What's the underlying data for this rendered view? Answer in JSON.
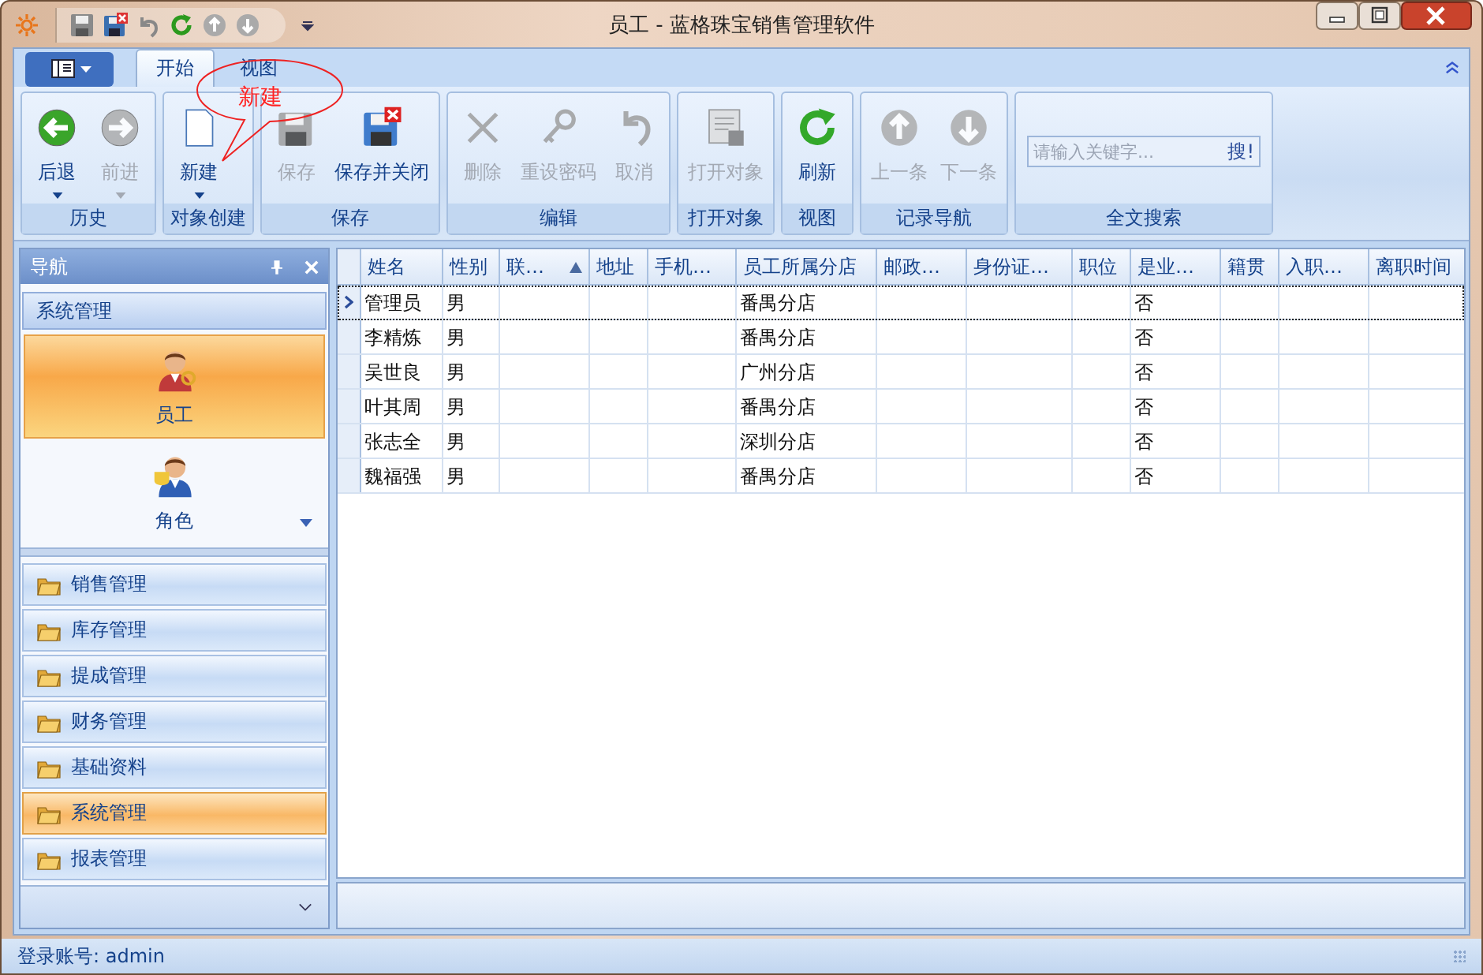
{
  "window": {
    "title": "员工 - 蓝格珠宝销售管理软件"
  },
  "ribbon": {
    "tabs": [
      {
        "label": "开始",
        "selected": true
      },
      {
        "label": "视图",
        "selected": false
      }
    ],
    "callout": {
      "text": "新建"
    },
    "groups": [
      {
        "caption": "历史",
        "buttons": [
          {
            "label": "后退",
            "kind": "back",
            "disabled": false,
            "dropdown": true
          },
          {
            "label": "前进",
            "kind": "forward",
            "disabled": true,
            "dropdown": true
          }
        ]
      },
      {
        "caption": "对象创建",
        "buttons": [
          {
            "label": "新建",
            "kind": "new",
            "disabled": false,
            "dropdown": true
          }
        ]
      },
      {
        "caption": "保存",
        "buttons": [
          {
            "label": "保存",
            "kind": "save",
            "disabled": true,
            "dropdown": false
          },
          {
            "label": "保存并关闭",
            "kind": "saveclose",
            "disabled": false,
            "dropdown": false
          }
        ]
      },
      {
        "caption": "编辑",
        "buttons": [
          {
            "label": "删除",
            "kind": "delete",
            "disabled": true,
            "dropdown": false
          },
          {
            "label": "重设密码",
            "kind": "key",
            "disabled": true,
            "dropdown": false
          },
          {
            "label": "取消",
            "kind": "undo",
            "disabled": true,
            "dropdown": false
          }
        ]
      },
      {
        "caption": "打开对象",
        "buttons": [
          {
            "label": "打开对象",
            "kind": "open",
            "disabled": true,
            "dropdown": false
          }
        ]
      },
      {
        "caption": "视图",
        "buttons": [
          {
            "label": "刷新",
            "kind": "refresh",
            "disabled": false,
            "dropdown": false
          }
        ]
      },
      {
        "caption": "记录导航",
        "buttons": [
          {
            "label": "上一条",
            "kind": "up",
            "disabled": true,
            "dropdown": false
          },
          {
            "label": "下一条",
            "kind": "down",
            "disabled": true,
            "dropdown": false
          }
        ]
      },
      {
        "caption": "全文搜索",
        "search": {
          "placeholder": "请输入关键字...",
          "button": "搜!"
        }
      }
    ]
  },
  "navigation": {
    "title": "导航",
    "group_header": "系统管理",
    "items": [
      {
        "label": "员工",
        "kind": "staff",
        "selected": true
      },
      {
        "label": "角色",
        "kind": "role",
        "selected": false
      }
    ],
    "categories": [
      {
        "label": "销售管理",
        "selected": false
      },
      {
        "label": "库存管理",
        "selected": false
      },
      {
        "label": "提成管理",
        "selected": false
      },
      {
        "label": "财务管理",
        "selected": false
      },
      {
        "label": "基础资料",
        "selected": false
      },
      {
        "label": "系统管理",
        "selected": true
      },
      {
        "label": "报表管理",
        "selected": false
      }
    ]
  },
  "table": {
    "columns": [
      {
        "label": "姓名",
        "sorted_ascending": false
      },
      {
        "label": "性别",
        "sorted_ascending": false
      },
      {
        "label": "联…",
        "sorted_ascending": true
      },
      {
        "label": "地址",
        "sorted_ascending": false
      },
      {
        "label": "手机…",
        "sorted_ascending": false
      },
      {
        "label": "员工所属分店",
        "sorted_ascending": false
      },
      {
        "label": "邮政…",
        "sorted_ascending": false
      },
      {
        "label": "身份证…",
        "sorted_ascending": false
      },
      {
        "label": "职位",
        "sorted_ascending": false
      },
      {
        "label": "是业…",
        "sorted_ascending": false
      },
      {
        "label": "籍贯",
        "sorted_ascending": false
      },
      {
        "label": "入职…",
        "sorted_ascending": false
      },
      {
        "label": "离职时间",
        "sorted_ascending": false
      }
    ],
    "rows": [
      {
        "selected": true,
        "cells": [
          "管理员",
          "男",
          "",
          "",
          "",
          "番禺分店",
          "",
          "",
          "",
          "否",
          "",
          "",
          ""
        ]
      },
      {
        "selected": false,
        "cells": [
          "李精炼",
          "男",
          "",
          "",
          "",
          "番禺分店",
          "",
          "",
          "",
          "否",
          "",
          "",
          ""
        ]
      },
      {
        "selected": false,
        "cells": [
          "吴世良",
          "男",
          "",
          "",
          "",
          "广州分店",
          "",
          "",
          "",
          "否",
          "",
          "",
          ""
        ]
      },
      {
        "selected": false,
        "cells": [
          "叶其周",
          "男",
          "",
          "",
          "",
          "番禺分店",
          "",
          "",
          "",
          "否",
          "",
          "",
          ""
        ]
      },
      {
        "selected": false,
        "cells": [
          "张志全",
          "男",
          "",
          "",
          "",
          "深圳分店",
          "",
          "",
          "",
          "否",
          "",
          "",
          ""
        ]
      },
      {
        "selected": false,
        "cells": [
          "魏福强",
          "男",
          "",
          "",
          "",
          "番禺分店",
          "",
          "",
          "",
          "否",
          "",
          "",
          ""
        ]
      }
    ]
  },
  "status_bar": {
    "text": "登录账号: admin"
  }
}
